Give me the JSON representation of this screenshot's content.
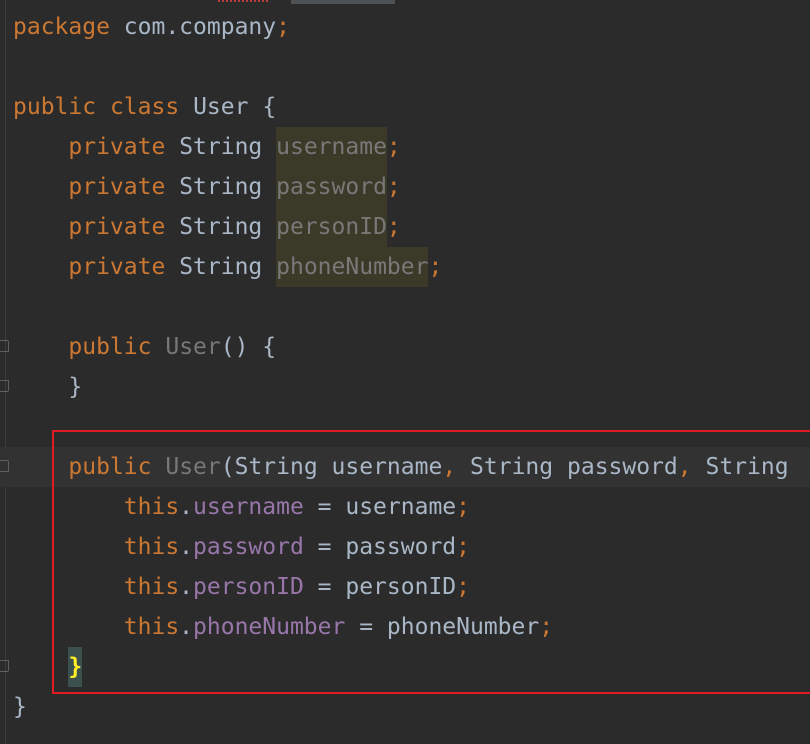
{
  "code": {
    "line1": {
      "kw": "package",
      "pkg": "com.company",
      "semi": ";"
    },
    "line3": {
      "kw1": "public",
      "kw2": "class",
      "name": "User",
      "brace": "{"
    },
    "fields": [
      {
        "kw": "private",
        "type": "String",
        "name": "username",
        "semi": ";"
      },
      {
        "kw": "private",
        "type": "String",
        "name": "password",
        "semi": ";"
      },
      {
        "kw": "private",
        "type": "String",
        "name": "personID",
        "semi": ";"
      },
      {
        "kw": "private",
        "type": "String",
        "name": "phoneNumber",
        "semi": ";"
      }
    ],
    "ctor1": {
      "kw": "public",
      "name": "User",
      "rest": "() {",
      "close": "}"
    },
    "ctor2": {
      "kw": "public",
      "name": "User",
      "open": "(",
      "p1_type": "String",
      "p1_name": "username",
      "comma1": ",",
      "p2_type": "String",
      "p2_name": "password",
      "comma2": ",",
      "p3_type": "String"
    },
    "assigns": [
      {
        "this": "this",
        "dot": ".",
        "field": "username",
        "eq": " = ",
        "value": "username",
        "semi": ";"
      },
      {
        "this": "this",
        "dot": ".",
        "field": "password",
        "eq": " = ",
        "value": "password",
        "semi": ";"
      },
      {
        "this": "this",
        "dot": ".",
        "field": "personID",
        "eq": " = ",
        "value": "personID",
        "semi": ";"
      },
      {
        "this": "this",
        "dot": ".",
        "field": "phoneNumber",
        "eq": " = ",
        "value": "phoneNumber",
        "semi": ";"
      }
    ],
    "ctor2_close": "}",
    "class_close": "}"
  },
  "colors": {
    "background": "#2b2b2b",
    "keyword": "#cc7832",
    "text": "#a9b7c6",
    "field": "#9876aa",
    "unused": "#787878",
    "annotation_box": "#e01b24"
  }
}
